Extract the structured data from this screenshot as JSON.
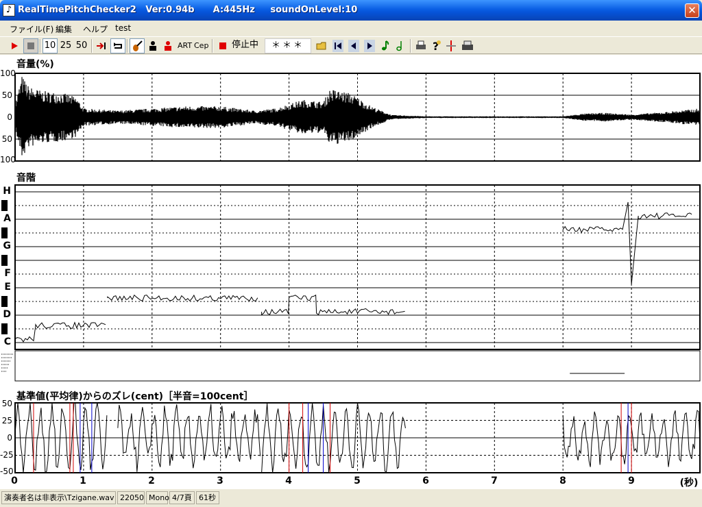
{
  "window": {
    "title": "RealTimePitchChecker2   Ver:0.94b      A:445Hz     soundOnLevel:10",
    "icon_glyph": "♪",
    "close_glyph": "✕"
  },
  "menu": [
    "ファイル(F)",
    "編集",
    "ヘルプ",
    "test"
  ],
  "toolbar": {
    "speed_buttons": [
      "10",
      "25",
      "50"
    ],
    "art_label": "ART",
    "cep_label": "Cep",
    "status_text": "停止中",
    "note_display": "＊＊＊",
    "icons": [
      "play-icon",
      "stop-icon",
      "jump-end-icon",
      "loop-icon",
      "violin-icon",
      "person-black-icon",
      "person-red-icon",
      "record-stop-icon",
      "open-folder-icon",
      "skip-first-icon",
      "step-back-icon",
      "step-forward-icon",
      "note-green-icon",
      "note-outline-icon",
      "print-icon",
      "help-icon",
      "cursor-icon",
      "printer-icon"
    ]
  },
  "panels": {
    "volume": {
      "label": "音量(%)",
      "y_ticks": [
        "100",
        "50",
        "0",
        "50",
        "100"
      ]
    },
    "scale": {
      "label": "音階",
      "notes": [
        "H",
        "A",
        "G",
        "F",
        "E",
        "D",
        "C"
      ]
    },
    "deviation": {
      "label": "基準値(平均律)からのズレ(cent)［半音=100cent］",
      "y_ticks": [
        "50",
        "25",
        "0",
        "-25",
        "-50"
      ]
    }
  },
  "x_axis": {
    "ticks": [
      "0",
      "1",
      "2",
      "3",
      "4",
      "5",
      "6",
      "7",
      "8",
      "9"
    ],
    "unit": "(秒)",
    "range_seconds": [
      0,
      10
    ]
  },
  "colors": {
    "titlebar": "#0a5fe4",
    "trace": "#000000",
    "marker_red": "#d00000",
    "marker_blue": "#0000cc",
    "grid_dashed": "#000000"
  },
  "chart_data": [
    {
      "type": "area",
      "title": "音量(%)",
      "xlim": [
        0,
        10
      ],
      "ylim": [
        -100,
        100
      ],
      "envelope": {
        "x": [
          0.0,
          0.1,
          0.2,
          0.4,
          0.7,
          0.9,
          1.0,
          1.5,
          2.0,
          2.5,
          3.0,
          3.5,
          3.8,
          4.2,
          4.5,
          4.6,
          4.9,
          5.2,
          5.5,
          6.0,
          7.0,
          8.0,
          8.3,
          8.6,
          9.0,
          9.5,
          10.0
        ],
        "y": [
          30,
          95,
          70,
          60,
          55,
          45,
          20,
          15,
          20,
          25,
          25,
          15,
          20,
          40,
          35,
          65,
          55,
          25,
          5,
          2,
          2,
          2,
          8,
          10,
          6,
          12,
          20
        ]
      },
      "grid": true
    },
    {
      "type": "line",
      "title": "音階",
      "xlim": [
        0,
        10
      ],
      "y_categories": [
        "C",
        "D",
        "E",
        "F",
        "G",
        "A",
        "H"
      ],
      "series": [
        {
          "x": [
            0.0,
            0.3,
            0.3,
            1.35
          ],
          "y": [
            "C",
            "C",
            "C#",
            "C#"
          ]
        },
        {
          "x": [
            1.35,
            3.55
          ],
          "y": [
            "D#",
            "D#"
          ]
        },
        {
          "x": [
            3.6,
            4.0,
            4.0,
            4.4,
            4.4,
            5.7
          ],
          "y": [
            "D",
            "D",
            "D#",
            "D#",
            "D",
            "D"
          ]
        },
        {
          "x": [
            8.0,
            8.9,
            8.95,
            9.0,
            9.1,
            9.9
          ],
          "y": [
            "G#",
            "G#",
            "A#",
            "E",
            "A",
            "A"
          ]
        }
      ]
    },
    {
      "type": "line",
      "title": "基準値(平均律)からのズレ(cent)［半音=100cent］",
      "xlim": [
        0,
        10
      ],
      "ylim": [
        -50,
        50
      ],
      "red_markers": [
        0.27,
        0.8,
        0.85,
        4.0,
        4.2,
        4.6,
        8.85,
        9.0
      ],
      "blue_markers": [
        0.95,
        1.12,
        4.28,
        4.5,
        8.95
      ],
      "grid": true
    }
  ],
  "statusbar": {
    "player": "演奏者名は非表示\\Tzigane.wav",
    "rate": "22050",
    "channels": "Mono",
    "page": "4/7頁",
    "duration": "61秒"
  }
}
